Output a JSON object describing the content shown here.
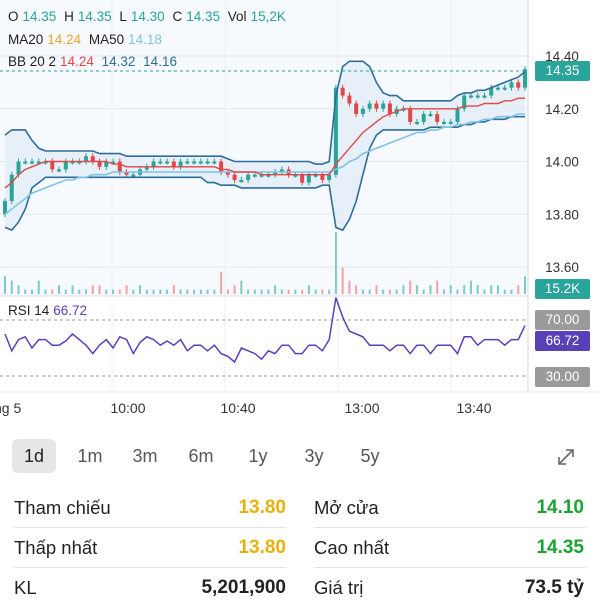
{
  "header": {
    "o_label": "O",
    "o_value": "14.35",
    "h_label": "H",
    "h_value": "14.35",
    "l_label": "L",
    "l_value": "14.30",
    "c_label": "C",
    "c_value": "14.35",
    "vol_label": "Vol",
    "vol_value": "15,2K",
    "ma20_label": "MA20",
    "ma20_value": "14.24",
    "ma50_label": "MA50",
    "ma50_value": "14.18",
    "bb_label": "BB 20 2",
    "bb_upper": "14.24",
    "bb_mid": "14.32",
    "bb_lower": "14.16"
  },
  "rsi_header": {
    "label": "RSI 14",
    "value": "66.72"
  },
  "tags": {
    "price": "14.35",
    "volume": "15.2K",
    "rsi_70": "70.00",
    "rsi_value": "66.72",
    "rsi_30": "30.00"
  },
  "colors": {
    "teal": "#2aa39a",
    "red": "#e04848",
    "orange": "#e7a532",
    "ma50": "#7ec3e6",
    "band": "#2d6e9a",
    "rsi": "#5a40b8",
    "gold": "#e7b10a",
    "green": "#19a330"
  },
  "chart_data": {
    "type": "candlestick",
    "y_ticks": [
      "14.40",
      "14.20",
      "14.00",
      "13.80",
      "13.60"
    ],
    "ylim": [
      13.55,
      14.45
    ],
    "x_ticks": [
      "ng 5",
      "10:00",
      "10:40",
      "13:00",
      "13:40"
    ],
    "close": [
      13.85,
      13.95,
      14.0,
      14.0,
      14.0,
      14.0,
      14.0,
      13.97,
      13.97,
      14.0,
      14.0,
      14.0,
      14.02,
      14.0,
      13.98,
      14.0,
      14.0,
      13.96,
      13.95,
      13.95,
      13.97,
      13.98,
      14.0,
      14.0,
      14.0,
      13.98,
      14.0,
      14.0,
      14.0,
      14.0,
      14.0,
      14.0,
      13.96,
      13.95,
      13.93,
      13.93,
      13.95,
      13.95,
      13.95,
      13.95,
      13.96,
      13.97,
      13.95,
      13.95,
      13.92,
      13.95,
      13.95,
      13.93,
      13.95,
      14.28,
      14.25,
      14.22,
      14.18,
      14.2,
      14.22,
      14.2,
      14.22,
      14.18,
      14.2,
      14.2,
      14.15,
      14.15,
      14.18,
      14.18,
      14.15,
      14.15,
      14.15,
      14.2,
      14.25,
      14.25,
      14.25,
      14.25,
      14.28,
      14.28,
      14.28,
      14.3,
      14.28,
      14.35
    ],
    "volume": [
      4,
      3,
      2,
      1,
      1,
      3,
      1,
      1,
      2,
      1,
      2,
      1,
      1,
      2,
      2,
      1,
      1,
      1,
      2,
      1,
      2,
      1,
      1,
      1,
      1,
      2,
      1,
      1,
      1,
      1,
      1,
      1,
      5,
      1,
      2,
      3,
      1,
      1,
      1,
      1,
      2,
      1,
      1,
      1,
      1,
      2,
      1,
      1,
      1,
      14,
      6,
      3,
      2,
      1,
      1,
      2,
      1,
      1,
      1,
      2,
      3,
      2,
      1,
      2,
      3,
      1,
      2,
      1,
      2,
      3,
      2,
      1,
      2,
      2,
      1,
      1,
      2,
      4
    ],
    "volume_unit": "K",
    "ma20": [
      13.9,
      13.92,
      13.95,
      13.97,
      13.98,
      13.99,
      14.0,
      14.0,
      14.0,
      14.0,
      14.0,
      14.0,
      14.0,
      14.0,
      14.0,
      14.0,
      13.99,
      13.99,
      13.98,
      13.98,
      13.98,
      13.98,
      13.98,
      13.98,
      13.98,
      13.98,
      13.98,
      13.98,
      13.98,
      13.98,
      13.98,
      13.98,
      13.97,
      13.97,
      13.96,
      13.96,
      13.96,
      13.96,
      13.95,
      13.95,
      13.95,
      13.95,
      13.95,
      13.95,
      13.95,
      13.95,
      13.95,
      13.95,
      13.95,
      13.99,
      14.02,
      14.05,
      14.08,
      14.11,
      14.13,
      14.15,
      14.17,
      14.18,
      14.19,
      14.2,
      14.2,
      14.2,
      14.2,
      14.2,
      14.2,
      14.2,
      14.2,
      14.2,
      14.21,
      14.21,
      14.21,
      14.22,
      14.22,
      14.22,
      14.23,
      14.23,
      14.24,
      14.24
    ],
    "ma50": [
      13.8,
      13.82,
      13.84,
      13.86,
      13.88,
      13.89,
      13.9,
      13.91,
      13.92,
      13.93,
      13.93,
      13.94,
      13.94,
      13.95,
      13.95,
      13.95,
      13.96,
      13.96,
      13.96,
      13.96,
      13.96,
      13.96,
      13.96,
      13.96,
      13.96,
      13.96,
      13.96,
      13.96,
      13.96,
      13.96,
      13.96,
      13.96,
      13.96,
      13.96,
      13.96,
      13.96,
      13.96,
      13.96,
      13.96,
      13.96,
      13.96,
      13.96,
      13.96,
      13.96,
      13.96,
      13.96,
      13.96,
      13.96,
      13.96,
      13.97,
      13.98,
      14.0,
      14.01,
      14.03,
      14.04,
      14.05,
      14.06,
      14.07,
      14.08,
      14.09,
      14.1,
      14.11,
      14.11,
      14.12,
      14.12,
      14.13,
      14.13,
      14.14,
      14.14,
      14.15,
      14.15,
      14.16,
      14.16,
      14.17,
      14.17,
      14.17,
      14.18,
      14.18
    ],
    "bb_upper": [
      14.1,
      14.12,
      14.12,
      14.12,
      14.08,
      14.05,
      14.04,
      14.04,
      14.04,
      14.04,
      14.04,
      14.04,
      14.04,
      14.04,
      14.03,
      14.03,
      14.03,
      14.03,
      14.02,
      14.02,
      14.02,
      14.02,
      14.02,
      14.02,
      14.02,
      14.02,
      14.02,
      14.02,
      14.02,
      14.02,
      14.02,
      14.02,
      14.02,
      14.01,
      14.0,
      14.0,
      14.0,
      14.0,
      14.0,
      14.0,
      14.0,
      14.0,
      14.0,
      14.0,
      14.0,
      14.0,
      13.99,
      13.99,
      14.0,
      14.25,
      14.36,
      14.38,
      14.38,
      14.38,
      14.36,
      14.3,
      14.26,
      14.25,
      14.25,
      14.23,
      14.23,
      14.23,
      14.23,
      14.23,
      14.23,
      14.23,
      14.23,
      14.25,
      14.26,
      14.26,
      14.27,
      14.27,
      14.28,
      14.29,
      14.3,
      14.31,
      14.32,
      14.34
    ],
    "bb_lower": [
      13.75,
      13.74,
      13.77,
      13.82,
      13.9,
      13.92,
      13.94,
      13.94,
      13.94,
      13.94,
      13.94,
      13.94,
      13.94,
      13.94,
      13.94,
      13.94,
      13.94,
      13.94,
      13.94,
      13.94,
      13.94,
      13.94,
      13.94,
      13.94,
      13.94,
      13.94,
      13.94,
      13.94,
      13.94,
      13.94,
      13.92,
      13.92,
      13.91,
      13.91,
      13.91,
      13.9,
      13.9,
      13.9,
      13.9,
      13.9,
      13.9,
      13.9,
      13.9,
      13.9,
      13.9,
      13.9,
      13.9,
      13.91,
      13.91,
      13.75,
      13.74,
      13.78,
      13.85,
      13.95,
      14.05,
      14.1,
      14.12,
      14.12,
      14.12,
      14.12,
      14.12,
      14.12,
      14.12,
      14.13,
      14.13,
      14.13,
      14.13,
      14.13,
      14.14,
      14.14,
      14.15,
      14.15,
      14.16,
      14.16,
      14.16,
      14.17,
      14.17,
      14.17
    ],
    "rsi": [
      60,
      48,
      56,
      58,
      50,
      56,
      56,
      52,
      52,
      55,
      60,
      56,
      52,
      46,
      52,
      56,
      50,
      58,
      56,
      46,
      54,
      58,
      56,
      52,
      55,
      52,
      56,
      48,
      52,
      52,
      48,
      52,
      46,
      44,
      40,
      50,
      48,
      46,
      42,
      48,
      46,
      52,
      52,
      46,
      46,
      52,
      52,
      48,
      56,
      86,
      72,
      62,
      60,
      58,
      52,
      52,
      52,
      48,
      52,
      52,
      46,
      52,
      52,
      46,
      52,
      52,
      52,
      46,
      58,
      58,
      52,
      56,
      56,
      56,
      52,
      56,
      56,
      66
    ],
    "rsi_levels": [
      70,
      30
    ]
  },
  "timeframes": {
    "tabs": [
      "1d",
      "1m",
      "3m",
      "6m",
      "1y",
      "3y",
      "5y"
    ],
    "active": "1d"
  },
  "stats": {
    "tham_chieu_label": "Tham chiếu",
    "tham_chieu_value": "13.80",
    "mo_cua_label": "Mở cửa",
    "mo_cua_value": "14.10",
    "thap_nhat_label": "Thấp nhất",
    "thap_nhat_value": "13.80",
    "cao_nhat_label": "Cao nhất",
    "cao_nhat_value": "14.35",
    "kl_label": "KL",
    "kl_value": "5,201,900",
    "gia_tri_label": "Giá trị",
    "gia_tri_value": "73.5 tỷ"
  }
}
